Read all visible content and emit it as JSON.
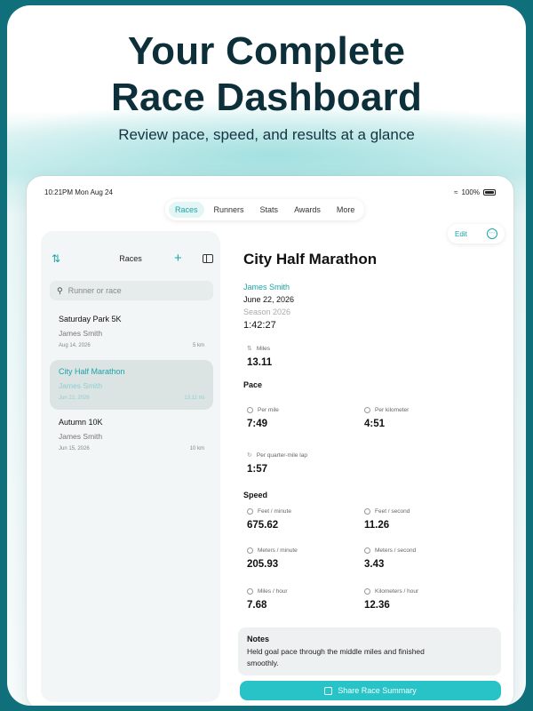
{
  "headline": {
    "line1": "Your Complete",
    "line2": "Race Dashboard",
    "subtitle": "Review pace, speed, and results at a glance"
  },
  "status_bar": {
    "time_date": "10:21PM  Mon Aug 24",
    "battery": "100%"
  },
  "tabs": [
    "Races",
    "Runners",
    "Stats",
    "Awards",
    "More"
  ],
  "active_tab": "Races",
  "toolbar": {
    "edit_label": "Edit",
    "more_icon": "ellipsis-circle-icon"
  },
  "sidebar": {
    "title": "Races",
    "search_placeholder": "Runner or race",
    "items": [
      {
        "name": "Saturday Park 5K",
        "runner": "James Smith",
        "date": "Aug 14, 2026",
        "distance": "5 km"
      },
      {
        "name": "City Half Marathon",
        "runner": "James Smith",
        "date": "Jun 22, 2026",
        "distance": "13.11 mi"
      },
      {
        "name": "Autumn 10K",
        "runner": "James Smith",
        "date": "Jun 15, 2026",
        "distance": "10 km"
      }
    ]
  },
  "detail": {
    "title": "City Half Marathon",
    "runner": "James Smith",
    "date": "June 22, 2026",
    "season": "Season 2026",
    "time": "1:42:27",
    "distance": {
      "label": "Miles",
      "value": "13.11"
    },
    "pace_section": "Pace",
    "pace": [
      {
        "label": "Per mile",
        "value": "7:49"
      },
      {
        "label": "Per kilometer",
        "value": "4:51"
      },
      {
        "label": "Per quarter-mile lap",
        "value": "1:57"
      }
    ],
    "speed_section": "Speed",
    "speed": [
      {
        "label": "Feet / minute",
        "value": "675.62"
      },
      {
        "label": "Feet / second",
        "value": "11.26"
      },
      {
        "label": "Meters / minute",
        "value": "205.93"
      },
      {
        "label": "Meters / second",
        "value": "3.43"
      },
      {
        "label": "Miles / hour",
        "value": "7.68"
      },
      {
        "label": "Kilometers / hour",
        "value": "12.36"
      }
    ],
    "notes_title": "Notes",
    "notes_text": "Held goal pace through the middle miles and finished smoothly.",
    "share_label": "Share Race Summary"
  },
  "colors": {
    "accent": "#27c3c7",
    "accent_text": "#1aa5a9",
    "heading": "#0d2f3a"
  }
}
